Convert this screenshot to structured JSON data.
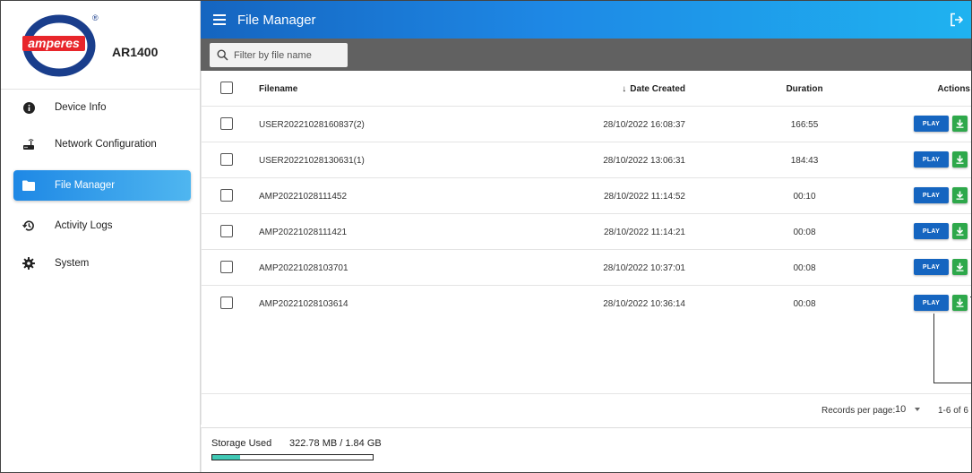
{
  "brand": {
    "logo_text": "amperes",
    "registered_mark": "®",
    "model": "AR1400"
  },
  "sidebar": {
    "items": [
      {
        "label": "Device Info",
        "icon": "info-icon",
        "active": false
      },
      {
        "label": "Network Configuration",
        "icon": "router-icon",
        "active": false
      },
      {
        "label": "File Manager",
        "icon": "folder-icon",
        "active": true
      },
      {
        "label": "Activity Logs",
        "icon": "history-icon",
        "active": false
      },
      {
        "label": "System",
        "icon": "gear-icon",
        "active": false
      }
    ]
  },
  "header": {
    "title": "File Manager",
    "menu_icon": "hamburger-icon",
    "logout_icon": "logout-icon"
  },
  "filter": {
    "placeholder": "Filter by file name",
    "value": ""
  },
  "table": {
    "columns": {
      "filename": "Filename",
      "date_created": "Date Created",
      "duration": "Duration",
      "actions": "Actions"
    },
    "sort_icon": "arrow-down-icon",
    "rows": [
      {
        "filename": "USER20221028160837(2)",
        "date": "28/10/2022 16:08:37",
        "duration": "166:55"
      },
      {
        "filename": "USER20221028130631(1)",
        "date": "28/10/2022 13:06:31",
        "duration": "184:43"
      },
      {
        "filename": "AMP20221028111452",
        "date": "28/10/2022 11:14:52",
        "duration": "00:10"
      },
      {
        "filename": "AMP20221028111421",
        "date": "28/10/2022 11:14:21",
        "duration": "00:08"
      },
      {
        "filename": "AMP20221028103701",
        "date": "28/10/2022 10:37:01",
        "duration": "00:08"
      },
      {
        "filename": "AMP20221028103614",
        "date": "28/10/2022 10:36:14",
        "duration": "00:08"
      }
    ],
    "play_label": "PLAY",
    "download_icon": "download-icon"
  },
  "pagination": {
    "records_per_page_label": "Records per page:",
    "records_per_page": "10",
    "range": "1-6 of 6"
  },
  "storage": {
    "label": "Storage Used",
    "value": "322.78 MB / 1.84 GB",
    "used_fraction": 0.171
  },
  "colors": {
    "header_start": "#1565c0",
    "header_end": "#1fb3f0",
    "play": "#1565c0",
    "download": "#2ea84b",
    "storage_fill": "#40c9b5",
    "filter_bar": "#616161"
  }
}
